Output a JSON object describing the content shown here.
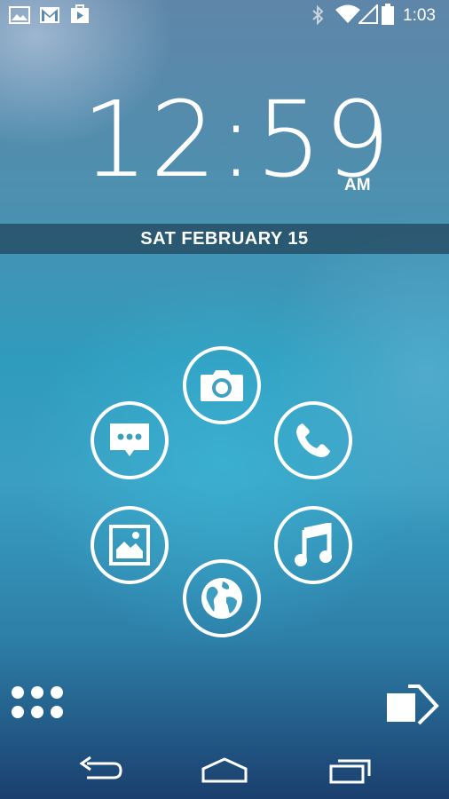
{
  "status_bar": {
    "notifications": [
      "gallery-icon",
      "gmail-icon",
      "play-store-icon"
    ],
    "indicators": [
      "bluetooth-icon",
      "wifi-icon",
      "signal-icon",
      "battery-icon"
    ],
    "time": "1:03"
  },
  "clock": {
    "time": "12:59",
    "ampm": "AM"
  },
  "date": "SAT FEBRUARY 15",
  "shortcuts": [
    "camera-icon",
    "phone-icon",
    "music-icon",
    "browser-icon",
    "gallery-icon",
    "messaging-icon"
  ],
  "bottom": {
    "left": "app-drawer-icon",
    "right": "unlock-arrow-icon"
  },
  "nav_bar": [
    "back-icon",
    "home-icon",
    "recents-icon"
  ],
  "colors": {
    "foreground": "#ffffff",
    "date_bar": "#19323c"
  }
}
